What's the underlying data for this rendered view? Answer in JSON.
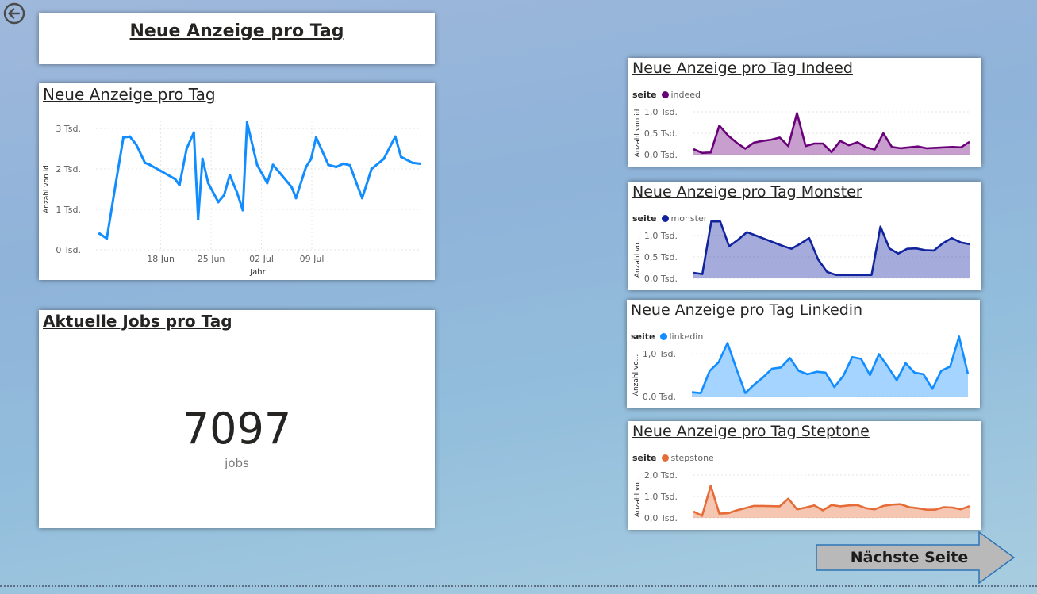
{
  "header": {
    "title": "Neue Anzeige pro Tag"
  },
  "nav": {
    "back_icon": "circle-arrow-left-icon",
    "next_label": "Nächste Seite",
    "next_color": "#b9b9b9"
  },
  "main_chart": {
    "title": "Neue Anzeige pro Tag",
    "chart_data": {
      "type": "line",
      "xlabel": "Jahr",
      "ylabel": "Anzahl von id",
      "ylim": [
        0,
        3000
      ],
      "yticks": [
        {
          "value": 0,
          "label": "0 Tsd."
        },
        {
          "value": 1000,
          "label": "1 Tsd."
        },
        {
          "value": 2000,
          "label": "2 Tsd."
        },
        {
          "value": 3000,
          "label": "3 Tsd."
        }
      ],
      "xlim": [
        0,
        45
      ],
      "xticks": [
        {
          "value": 9,
          "label": "18 Jun"
        },
        {
          "value": 16,
          "label": "25 Jun"
        },
        {
          "value": 23,
          "label": "02 Jul"
        },
        {
          "value": 30,
          "label": "09 Jul"
        }
      ],
      "color": "#118dff",
      "series": [
        {
          "x": [
            0.5,
            1.5,
            2.8,
            3.8,
            4.7,
            5.6,
            6.8,
            7.5,
            9.0,
            11.0,
            11.6,
            12.6,
            13.6,
            14.2,
            14.8,
            15.6,
            16.4,
            17.0,
            17.8,
            18.6,
            19.6,
            20.4,
            21.0,
            22.4,
            23.8,
            24.6,
            25.8,
            27.2,
            27.8,
            29.2,
            29.9,
            30.6,
            32.3,
            33.4,
            34.4,
            35.3,
            36.2,
            37.0,
            38.3,
            40.0,
            41.6,
            42.4,
            44.0,
            45.0
          ],
          "y": [
            400,
            280,
            1700,
            2780,
            2800,
            2600,
            2150,
            2100,
            1950,
            1750,
            1600,
            2500,
            2900,
            760,
            2250,
            1650,
            1380,
            1180,
            1350,
            1850,
            1420,
            980,
            3150,
            2100,
            1650,
            2100,
            1850,
            1550,
            1280,
            2050,
            2250,
            2780,
            2100,
            2050,
            2130,
            2090,
            1650,
            1280,
            2000,
            2250,
            2800,
            2300,
            2150,
            2130
          ]
        }
      ]
    }
  },
  "kpi": {
    "title": "Aktuelle Jobs pro Tag",
    "value": "7097",
    "label": "jobs"
  },
  "mini_charts": [
    {
      "title": "Neue Anzeige pro Tag Indeed",
      "legend_title": "seite",
      "chart_data": {
        "type": "area",
        "ylabel": "Anzahl von id",
        "yticks": [
          {
            "value": 0,
            "label": "0,0 Tsd."
          },
          {
            "value": 500,
            "label": "0,5 Tsd."
          },
          {
            "value": 1000,
            "label": "1,0 Tsd."
          }
        ],
        "ylim": [
          0,
          1000
        ],
        "color": "#6b007b",
        "series": [
          {
            "name": "indeed",
            "y": [
              130,
              40,
              50,
              680,
              450,
              280,
              140,
              280,
              320,
              350,
              400,
              200,
              970,
              200,
              260,
              260,
              60,
              320,
              220,
              290,
              170,
              120,
              500,
              180,
              150,
              170,
              190,
              150,
              160,
              170,
              180,
              170,
              300
            ]
          }
        ]
      }
    },
    {
      "title": "Neue Anzeige pro Tag Monster",
      "legend_title": "seite",
      "chart_data": {
        "type": "area",
        "ylabel": "Anzahl vo...",
        "yticks": [
          {
            "value": 0,
            "label": "0,0 Tsd."
          },
          {
            "value": 500,
            "label": "0,5 Tsd."
          },
          {
            "value": 1000,
            "label": "1,0 Tsd."
          }
        ],
        "ylim": [
          0,
          1000
        ],
        "color": "#12239e",
        "series": [
          {
            "name": "monster",
            "y": [
              130,
              100,
              1330,
              1330,
              750,
              900,
              1080,
              1000,
              920,
              840,
              760,
              690,
              810,
              940,
              440,
              150,
              80,
              80,
              80,
              80,
              80,
              1210,
              700,
              580,
              690,
              700,
              660,
              650,
              820,
              940,
              840,
              800
            ]
          }
        ]
      }
    },
    {
      "title": "Neue Anzeige pro Tag Linkedin",
      "legend_title": "seite",
      "chart_data": {
        "type": "area",
        "ylabel": "Anzahl vo...",
        "yticks": [
          {
            "value": 0,
            "label": "0,0 Tsd."
          },
          {
            "value": 1000,
            "label": "1,0 Tsd."
          }
        ],
        "ylim": [
          0,
          1000
        ],
        "color": "#118dff",
        "series": [
          {
            "name": "linkedin",
            "y": [
              100,
              80,
              600,
              800,
              1250,
              650,
              80,
              280,
              450,
              650,
              680,
              900,
              600,
              520,
              580,
              560,
              220,
              480,
              920,
              880,
              500,
              990,
              700,
              380,
              780,
              560,
              520,
              180,
              600,
              700,
              1400,
              520
            ]
          }
        ]
      }
    },
    {
      "title": "Neue Anzeige pro Tag Steptone",
      "legend_title": "seite",
      "chart_data": {
        "type": "area",
        "ylabel": "Anzahl vo...",
        "yticks": [
          {
            "value": 0,
            "label": "0,0 Tsd."
          },
          {
            "value": 1000,
            "label": "1,0 Tsd."
          },
          {
            "value": 2000,
            "label": "2,0 Tsd."
          }
        ],
        "ylim": [
          0,
          2000
        ],
        "color": "#e66c37",
        "series": [
          {
            "name": "stepstone",
            "y": [
              300,
              100,
              1500,
              200,
              220,
              350,
              450,
              560,
              560,
              550,
              540,
              900,
              400,
              480,
              580,
              350,
              600,
              540,
              580,
              600,
              450,
              400,
              560,
              620,
              640,
              500,
              450,
              380,
              380,
              500,
              480,
              400,
              550
            ]
          }
        ]
      }
    }
  ]
}
